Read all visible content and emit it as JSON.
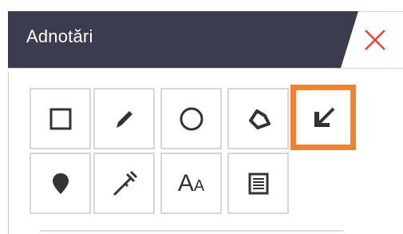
{
  "panel": {
    "title": "Adnotări",
    "close_icon": "close-x-icon",
    "accent_color": "#f08333",
    "title_bar_color": "#3b3c4e",
    "close_color": "#e2433f"
  },
  "tools": [
    {
      "name": "rectangle",
      "icon": "square-outline-icon"
    },
    {
      "name": "pencil",
      "icon": "pencil-icon"
    },
    {
      "name": "circle",
      "icon": "circle-outline-icon"
    },
    {
      "name": "polygon",
      "icon": "polygon-outline-icon"
    },
    {
      "name": "arrow",
      "icon": "arrow-down-left-icon",
      "active": true
    },
    {
      "name": "marker",
      "icon": "map-pin-icon"
    },
    {
      "name": "measure",
      "icon": "caliper-icon"
    },
    {
      "name": "text",
      "icon": "text-aa-icon",
      "glyph_big": "A",
      "glyph_small": "A"
    },
    {
      "name": "note",
      "icon": "note-list-icon"
    }
  ]
}
